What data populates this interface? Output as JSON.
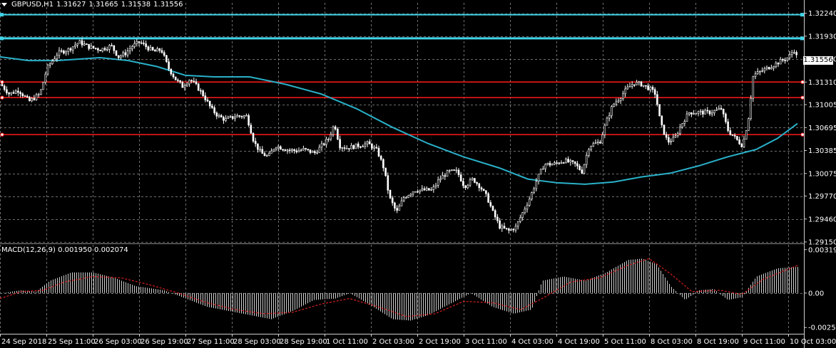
{
  "header": {
    "symbol": "GBPUSD,H1",
    "open": "1.31627",
    "high": "1.31665",
    "low": "1.31538",
    "close": "1.31556"
  },
  "macd_header": {
    "label": "MACD(12,26,9)",
    "value1": "0.001950",
    "value2": "0.002074"
  },
  "current_price": "1.31556",
  "colors": {
    "background": "#000000",
    "grid": "#6e6e6e",
    "candle": "#ffffff",
    "ma_line": "#2ab0c8",
    "cyan_level": "#3fd3e8",
    "red_level": "#ff1a1a",
    "macd_signal": "#d42020"
  },
  "chart_data": {
    "type": "candlestick",
    "price_axis_ticks": [
      "1.32240",
      "1.31930",
      "1.31620",
      "1.31310",
      "1.31005",
      "1.30695",
      "1.30385",
      "1.30075",
      "1.29770",
      "1.29460",
      "1.29150"
    ],
    "macd_axis_ticks": [
      "0.003196",
      "0.00",
      "-0.0025"
    ],
    "time_axis_labels": [
      "24 Sep 2018",
      "25 Sep 11:00",
      "26 Sep 03:00",
      "26 Sep 19:00",
      "27 Sep 11:00",
      "28 Sep 03:00",
      "28 Sep 19:00",
      "1 Oct 11:00",
      "2 Oct 03:00",
      "2 Oct 19:00",
      "3 Oct 11:00",
      "4 Oct 03:00",
      "4 Oct 19:00",
      "5 Oct 11:00",
      "8 Oct 03:00",
      "8 Oct 19:00",
      "9 Oct 11:00",
      "10 Oct 03:00"
    ],
    "ylim": [
      1.2915,
      1.3238
    ],
    "macd_ylim": [
      -0.0028,
      0.0035
    ],
    "levels": [
      {
        "price": 1.3222,
        "color": "cyan"
      },
      {
        "price": 1.319,
        "color": "cyan"
      },
      {
        "price": 1.3131,
        "color": "red"
      },
      {
        "price": 1.311,
        "color": "red"
      },
      {
        "price": 1.306,
        "color": "red"
      }
    ],
    "close_path": [
      [
        0,
        1.3128
      ],
      [
        12,
        1.3115
      ],
      [
        25,
        1.312
      ],
      [
        40,
        1.3105
      ],
      [
        55,
        1.3115
      ],
      [
        65,
        1.315
      ],
      [
        80,
        1.317
      ],
      [
        95,
        1.3175
      ],
      [
        110,
        1.3185
      ],
      [
        125,
        1.3178
      ],
      [
        140,
        1.3175
      ],
      [
        155,
        1.318
      ],
      [
        165,
        1.3165
      ],
      [
        175,
        1.317
      ],
      [
        185,
        1.318
      ],
      [
        195,
        1.3185
      ],
      [
        205,
        1.3178
      ],
      [
        215,
        1.3172
      ],
      [
        225,
        1.3175
      ],
      [
        235,
        1.315
      ],
      [
        245,
        1.3135
      ],
      [
        255,
        1.3125
      ],
      [
        265,
        1.3135
      ],
      [
        275,
        1.3125
      ],
      [
        285,
        1.3112
      ],
      [
        295,
        1.3095
      ],
      [
        305,
        1.3085
      ],
      [
        315,
        1.308
      ],
      [
        330,
        1.3085
      ],
      [
        345,
        1.3085
      ],
      [
        355,
        1.305
      ],
      [
        365,
        1.3035
      ],
      [
        375,
        1.303
      ],
      [
        385,
        1.3045
      ],
      [
        400,
        1.304
      ],
      [
        415,
        1.3038
      ],
      [
        425,
        1.304
      ],
      [
        440,
        1.3035
      ],
      [
        450,
        1.3045
      ],
      [
        460,
        1.3055
      ],
      [
        468,
        1.3075
      ],
      [
        475,
        1.3045
      ],
      [
        485,
        1.3042
      ],
      [
        500,
        1.3045
      ],
      [
        515,
        1.3048
      ],
      [
        528,
        1.3038
      ],
      [
        537,
        1.3015
      ],
      [
        545,
        1.2975
      ],
      [
        555,
        1.2955
      ],
      [
        565,
        1.2975
      ],
      [
        580,
        1.2985
      ],
      [
        595,
        1.2985
      ],
      [
        605,
        1.2985
      ],
      [
        615,
        1.3
      ],
      [
        628,
        1.301
      ],
      [
        640,
        1.301
      ],
      [
        650,
        1.299
      ],
      [
        662,
        1.3
      ],
      [
        672,
        1.299
      ],
      [
        682,
        1.2975
      ],
      [
        690,
        1.2955
      ],
      [
        700,
        1.2935
      ],
      [
        712,
        1.293
      ],
      [
        722,
        1.2935
      ],
      [
        732,
        1.2955
      ],
      [
        742,
        1.2975
      ],
      [
        752,
        1.3
      ],
      [
        762,
        1.302
      ],
      [
        775,
        1.302
      ],
      [
        790,
        1.3025
      ],
      [
        805,
        1.302
      ],
      [
        815,
        1.301
      ],
      [
        825,
        1.3045
      ],
      [
        840,
        1.305
      ],
      [
        848,
        1.3075
      ],
      [
        858,
        1.31
      ],
      [
        868,
        1.311
      ],
      [
        878,
        1.3122
      ],
      [
        888,
        1.313
      ],
      [
        898,
        1.3128
      ],
      [
        910,
        1.3122
      ],
      [
        918,
        1.3115
      ],
      [
        925,
        1.3075
      ],
      [
        935,
        1.305
      ],
      [
        945,
        1.3055
      ],
      [
        955,
        1.3075
      ],
      [
        965,
        1.309
      ],
      [
        980,
        1.309
      ],
      [
        995,
        1.309
      ],
      [
        1010,
        1.3095
      ],
      [
        1020,
        1.3065
      ],
      [
        1030,
        1.3055
      ],
      [
        1040,
        1.3045
      ],
      [
        1048,
        1.308
      ],
      [
        1055,
        1.314
      ],
      [
        1065,
        1.3145
      ],
      [
        1075,
        1.315
      ],
      [
        1085,
        1.3155
      ],
      [
        1095,
        1.316
      ],
      [
        1105,
        1.3165
      ],
      [
        1112,
        1.3175
      ],
      [
        1118,
        1.316
      ]
    ],
    "ma_path": [
      [
        0,
        1.3165
      ],
      [
        40,
        1.316
      ],
      [
        80,
        1.316
      ],
      [
        140,
        1.3164
      ],
      [
        180,
        1.316
      ],
      [
        220,
        1.3152
      ],
      [
        260,
        1.314
      ],
      [
        300,
        1.3138
      ],
      [
        350,
        1.3138
      ],
      [
        400,
        1.3128
      ],
      [
        450,
        1.3115
      ],
      [
        500,
        1.3095
      ],
      [
        550,
        1.307
      ],
      [
        600,
        1.3048
      ],
      [
        650,
        1.303
      ],
      [
        700,
        1.3015
      ],
      [
        740,
        1.3
      ],
      [
        780,
        1.2995
      ],
      [
        820,
        1.2993
      ],
      [
        860,
        1.2996
      ],
      [
        900,
        1.3003
      ],
      [
        940,
        1.3008
      ],
      [
        980,
        1.3018
      ],
      [
        1020,
        1.303
      ],
      [
        1060,
        1.304
      ],
      [
        1090,
        1.3055
      ],
      [
        1118,
        1.3075
      ]
    ],
    "macd_hist_path": [
      [
        0,
        0.0
      ],
      [
        30,
        0.0002
      ],
      [
        50,
        0.0001
      ],
      [
        70,
        0.0009
      ],
      [
        100,
        0.0015
      ],
      [
        130,
        0.0015
      ],
      [
        160,
        0.0011
      ],
      [
        190,
        0.0005
      ],
      [
        230,
        0.0002
      ],
      [
        260,
        -0.0004
      ],
      [
        290,
        -0.001
      ],
      [
        320,
        -0.0013
      ],
      [
        350,
        -0.0016
      ],
      [
        380,
        -0.0019
      ],
      [
        410,
        -0.0013
      ],
      [
        440,
        -0.0005
      ],
      [
        470,
        -0.0004
      ],
      [
        490,
        0.0
      ],
      [
        520,
        -0.0009
      ],
      [
        550,
        -0.0019
      ],
      [
        575,
        -0.002
      ],
      [
        600,
        -0.0016
      ],
      [
        630,
        -0.0008
      ],
      [
        660,
        0.0
      ],
      [
        690,
        -0.001
      ],
      [
        720,
        -0.0015
      ],
      [
        745,
        -0.0012
      ],
      [
        760,
        0.0009
      ],
      [
        790,
        0.0012
      ],
      [
        820,
        0.0009
      ],
      [
        850,
        0.0015
      ],
      [
        880,
        0.0024
      ],
      [
        900,
        0.0025
      ],
      [
        920,
        0.0021
      ],
      [
        940,
        0.0005
      ],
      [
        960,
        -0.0005
      ],
      [
        980,
        0.0002
      ],
      [
        1000,
        0.0003
      ],
      [
        1020,
        -0.0005
      ],
      [
        1040,
        -0.0003
      ],
      [
        1060,
        0.0012
      ],
      [
        1090,
        0.0018
      ],
      [
        1118,
        0.0019
      ]
    ],
    "macd_signal_path": [
      [
        0,
        -0.0004
      ],
      [
        30,
        0.0001
      ],
      [
        60,
        0.0002
      ],
      [
        90,
        0.0008
      ],
      [
        130,
        0.0012
      ],
      [
        170,
        0.0011
      ],
      [
        210,
        0.0006
      ],
      [
        250,
        0.0
      ],
      [
        290,
        -0.0007
      ],
      [
        330,
        -0.0012
      ],
      [
        370,
        -0.0015
      ],
      [
        410,
        -0.0014
      ],
      [
        450,
        -0.0008
      ],
      [
        490,
        -0.0004
      ],
      [
        530,
        -0.001
      ],
      [
        570,
        -0.0017
      ],
      [
        610,
        -0.0015
      ],
      [
        650,
        -0.0006
      ],
      [
        690,
        -0.0007
      ],
      [
        730,
        -0.0012
      ],
      [
        760,
        -0.0004
      ],
      [
        800,
        0.0008
      ],
      [
        840,
        0.0011
      ],
      [
        880,
        0.002
      ],
      [
        910,
        0.0025
      ],
      [
        940,
        0.0014
      ],
      [
        970,
        0.0001
      ],
      [
        1010,
        0.0002
      ],
      [
        1040,
        -0.0001
      ],
      [
        1070,
        0.001
      ],
      [
        1118,
        0.002
      ]
    ]
  }
}
